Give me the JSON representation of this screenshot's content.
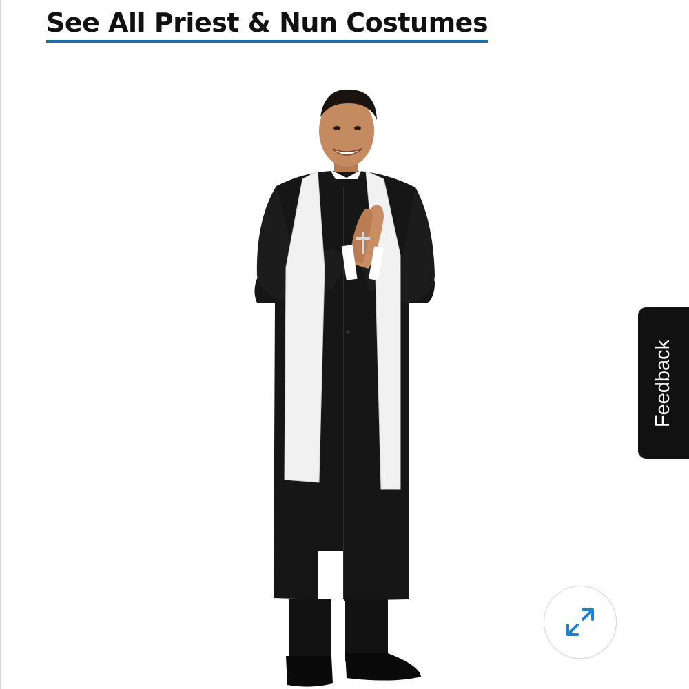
{
  "category_link": {
    "label": "See All Priest & Nun Costumes"
  },
  "product_image": {
    "icon": "priest-costume-photo"
  },
  "feedback_tab": {
    "label": "Feedback"
  },
  "expand_button": {
    "icon": "expand-arrows-icon"
  },
  "colors": {
    "link_underline": "#1a73a8",
    "expand_icon": "#1e7fd6",
    "feedback_bg": "#111111"
  }
}
